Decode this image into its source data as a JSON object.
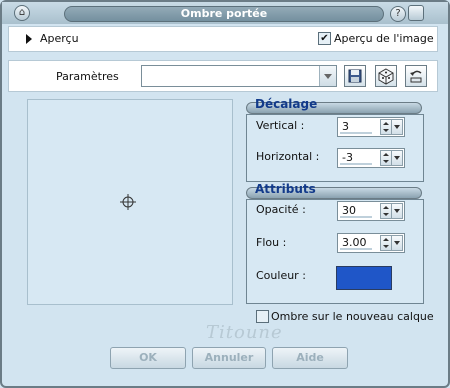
{
  "window": {
    "title": "Ombre portée"
  },
  "preview": {
    "label": "Aperçu",
    "image_preview_label": "Aperçu de l'image",
    "image_preview_checked": true
  },
  "params": {
    "label": "Paramètres",
    "value": ""
  },
  "decalage": {
    "title": "Décalage",
    "vertical_label": "Vertical :",
    "vertical_value": "3",
    "horizontal_label": "Horizontal :",
    "horizontal_value": "-3"
  },
  "attributs": {
    "title": "Attributs",
    "opacity_label": "Opacité :",
    "opacity_value": "30",
    "blur_label": "Flou :",
    "blur_value": "3.00",
    "color_label": "Couleur :",
    "color_value": "#1f56c8"
  },
  "new_layer": {
    "label": "Ombre sur le nouveau calque",
    "checked": false
  },
  "watermark": "Titoune",
  "buttons": {
    "ok": "OK",
    "cancel": "Annuler",
    "help": "Aide"
  },
  "colors": {
    "accent": "#123a8a",
    "background": "#d2e4f0"
  }
}
